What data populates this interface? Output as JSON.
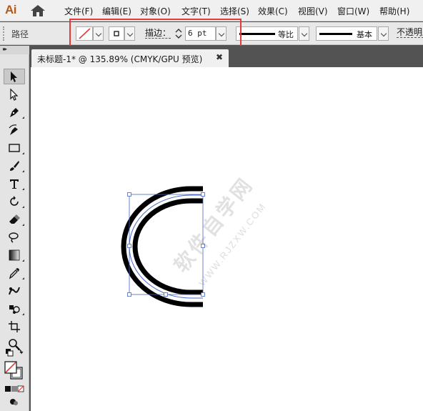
{
  "app": {
    "logo": "Ai"
  },
  "menu": [
    {
      "label": "文件(F)"
    },
    {
      "label": "编辑(E)"
    },
    {
      "label": "对象(O)"
    },
    {
      "label": "文字(T)"
    },
    {
      "label": "选择(S)"
    },
    {
      "label": "效果(C)"
    },
    {
      "label": "视图(V)"
    },
    {
      "label": "窗口(W)"
    },
    {
      "label": "帮助(H)"
    }
  ],
  "control": {
    "selection_type": "路径",
    "stroke_label": "描边：",
    "stroke_weight": "6 pt",
    "variable_width_profile": "等比",
    "brush_definition": "基本",
    "opacity_label": "不透明度"
  },
  "document": {
    "tab_title": "未标题-1* @ 135.89% (CMYK/GPU 预览)",
    "close_glyph": "✖"
  },
  "canvas": {
    "watermark": "软件自学网",
    "watermark_url": "WWW.RJZXW.COM"
  },
  "colors": {
    "highlight": "#e53a3a",
    "selection": "#4466cc",
    "logo": "#b25a1c"
  },
  "tools": [
    {
      "name": "selection-tool-icon"
    },
    {
      "name": "direct-selection-tool-icon"
    },
    {
      "name": "pen-tool-icon"
    },
    {
      "name": "curvature-tool-icon"
    },
    {
      "name": "rectangle-tool-icon"
    },
    {
      "name": "paintbrush-tool-icon"
    },
    {
      "name": "type-tool-icon"
    },
    {
      "name": "rotate-tool-icon"
    },
    {
      "name": "eraser-tool-icon"
    },
    {
      "name": "lasso-tool-icon"
    },
    {
      "name": "gradient-tool-icon"
    },
    {
      "name": "eyedropper-tool-icon"
    },
    {
      "name": "blend-tool-icon"
    },
    {
      "name": "symbol-sprayer-tool-icon"
    },
    {
      "name": "artboard-tool-icon"
    },
    {
      "name": "zoom-tool-icon"
    },
    {
      "name": "fill-stroke-icon"
    },
    {
      "name": "color-mode-icon"
    },
    {
      "name": "draw-mode-icon"
    }
  ]
}
